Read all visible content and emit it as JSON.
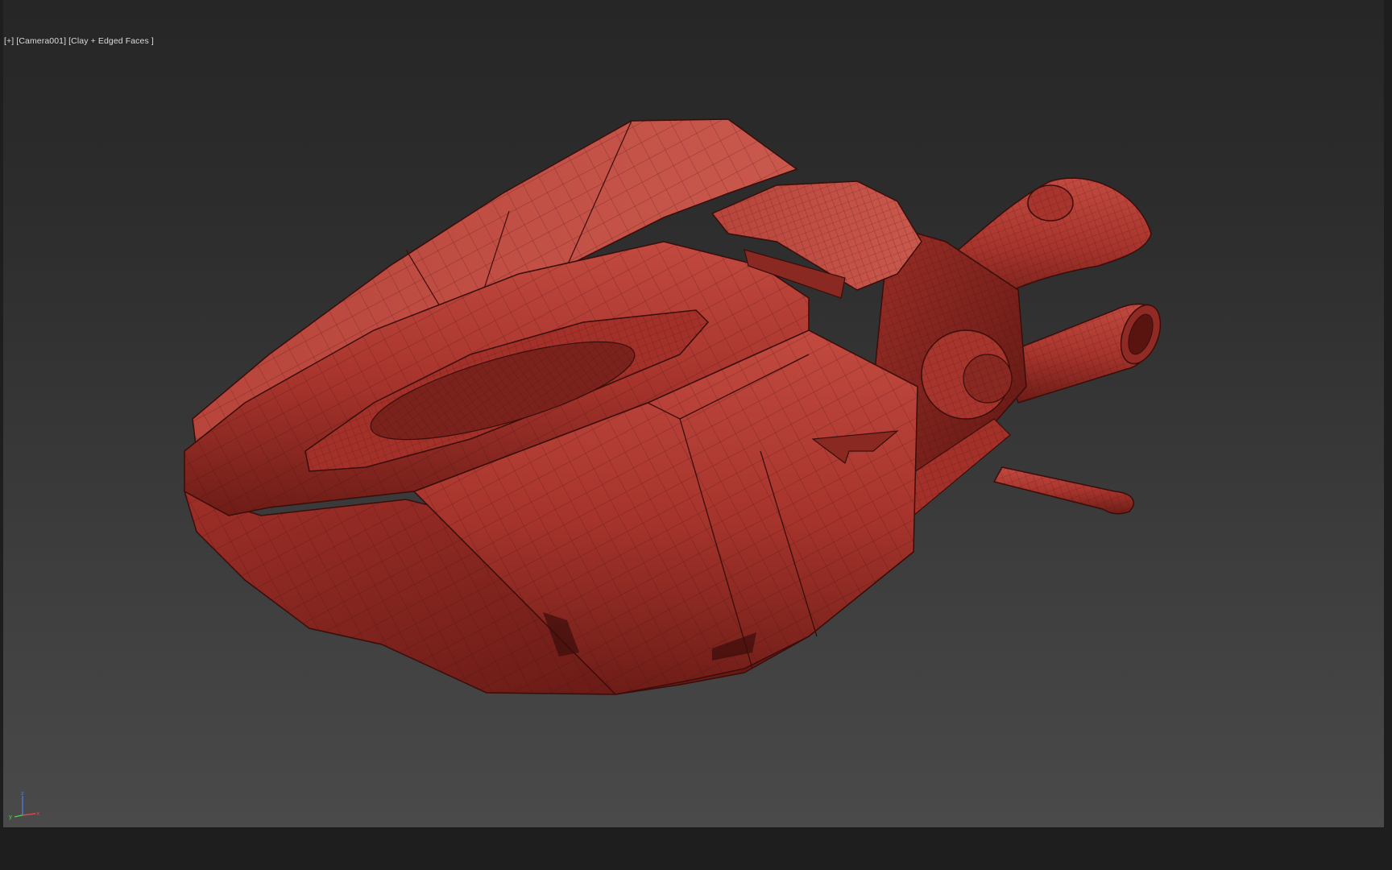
{
  "viewport": {
    "label_plus": "[+]",
    "label_camera": "[Camera001]",
    "label_shading": "[Clay + Edged Faces ]",
    "model_color": "#b33a32",
    "edge_color": "#3a0d0a",
    "background_top": "#262626",
    "background_bottom": "#4a4a4a"
  },
  "axis_gizmo": {
    "z_label": "z",
    "x_label": "x",
    "y_label": "y",
    "z_color": "#4a7ad8",
    "x_color": "#d84a4a",
    "y_color": "#4ad84a"
  }
}
